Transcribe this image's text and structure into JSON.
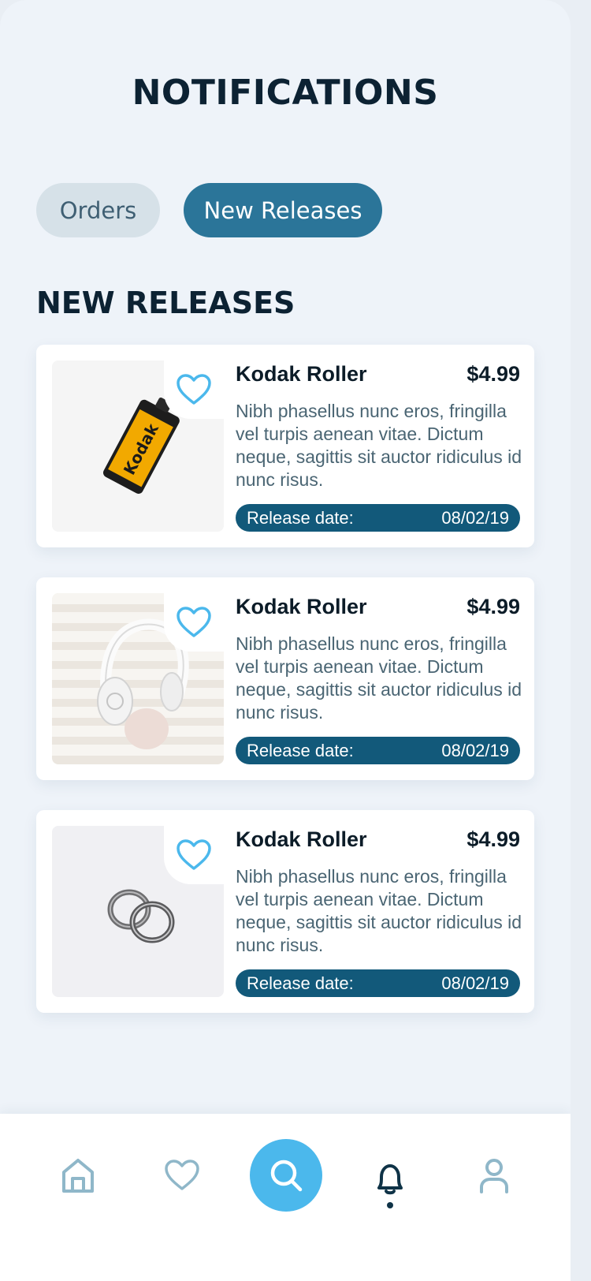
{
  "header": {
    "title": "NOTIFICATIONS"
  },
  "tabs": [
    {
      "label": "Orders",
      "active": false
    },
    {
      "label": "New Releases",
      "active": true
    }
  ],
  "section": {
    "title": "NEW RELEASES"
  },
  "cards": [
    {
      "name": "Kodak Roller",
      "price": "$4.99",
      "description": "Nibh phasellus nunc eros, fringilla vel turpis aenean vitae. Dictum neque, sagittis sit auctor ridiculus id nunc risus.",
      "release_label": "Release date:",
      "release_date": "08/02/19",
      "image": "film-roll"
    },
    {
      "name": "Kodak Roller",
      "price": "$4.99",
      "description": "Nibh phasellus nunc eros, fringilla vel turpis aenean vitae. Dictum neque, sagittis sit auctor ridiculus id nunc risus.",
      "release_label": "Release date:",
      "release_date": "08/02/19",
      "image": "headphones"
    },
    {
      "name": "Kodak Roller",
      "price": "$4.99",
      "description": "Nibh phasellus nunc eros, fringilla vel turpis aenean vitae. Dictum neque, sagittis sit auctor ridiculus id nunc risus.",
      "release_label": "Release date:",
      "release_date": "08/02/19",
      "image": "rings"
    }
  ],
  "film_logo": "Kodak",
  "bottom_nav": [
    "home-icon",
    "heart-icon",
    "search-icon",
    "bell-icon",
    "user-icon"
  ],
  "colors": {
    "accent": "#4bb8ec",
    "primary": "#2b7599",
    "release_bar": "#12597a",
    "heart": "#4bb8ec"
  }
}
